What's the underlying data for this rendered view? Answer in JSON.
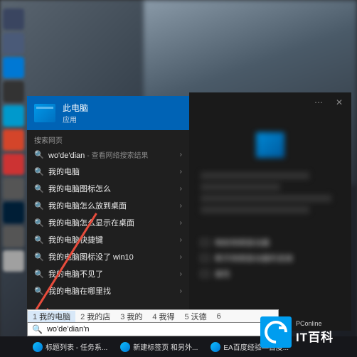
{
  "best_match": {
    "title": "此电脑",
    "subtitle": "应用"
  },
  "web_section": "搜索网页",
  "results": [
    {
      "icon": "🔍",
      "text": "wo'de'dian",
      "sub": "- 查看网络搜索结果",
      "chevron": true
    },
    {
      "icon": "🔍",
      "text": "我的电脑",
      "chevron": true
    },
    {
      "icon": "🔍",
      "text": "我的电脑图标怎么",
      "chevron": true
    },
    {
      "icon": "🔍",
      "text": "我的电脑怎么放到桌面",
      "chevron": true
    },
    {
      "icon": "🔍",
      "text": "我的电脑怎么显示在桌面",
      "chevron": true
    },
    {
      "icon": "🔍",
      "text": "我的电脑快捷键",
      "chevron": true
    },
    {
      "icon": "🔍",
      "text": "我的电脑图标没了 win10",
      "chevron": true
    },
    {
      "icon": "🔍",
      "text": "我的电脑不见了",
      "chevron": true
    },
    {
      "icon": "🔍",
      "text": "我的电脑在哪里找",
      "chevron": true
    }
  ],
  "context_actions": [
    {
      "label": "映射网络驱动器"
    },
    {
      "label": "断开网络驱动器的连接"
    },
    {
      "label": "属性"
    }
  ],
  "ime": {
    "candidates": [
      {
        "n": "1",
        "t": "我的电脑"
      },
      {
        "n": "2",
        "t": "我的店"
      },
      {
        "n": "3",
        "t": "我的"
      },
      {
        "n": "4",
        "t": "我得"
      },
      {
        "n": "5",
        "t": "沃德"
      },
      {
        "n": "6",
        "t": ""
      }
    ]
  },
  "search_input": "wo'de'dian'n",
  "taskbar": [
    {
      "label": "标题列表 - 任务系..."
    },
    {
      "label": "新建标签页 和另外..."
    },
    {
      "label": "EA百度经验—百度..."
    }
  ],
  "logo": {
    "top": "PConline",
    "main": "IT百科"
  }
}
